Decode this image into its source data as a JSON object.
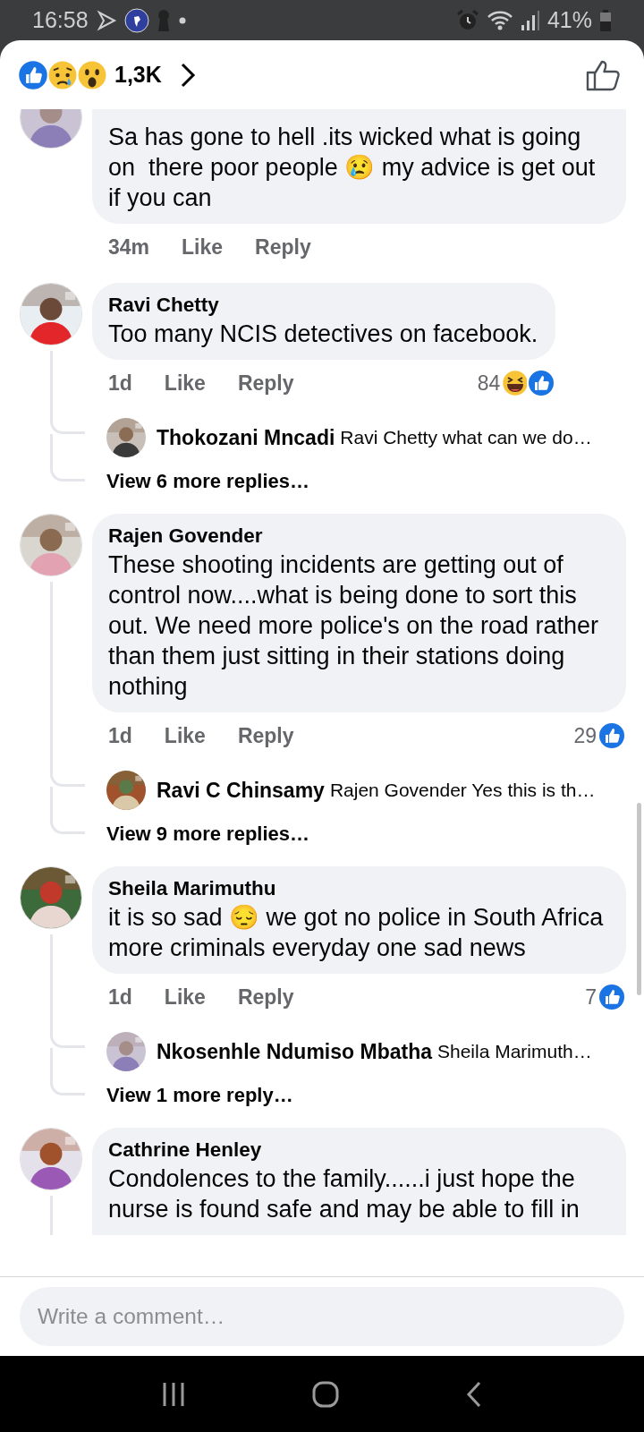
{
  "status_bar": {
    "time": "16:58",
    "battery": "41%"
  },
  "reactions_summary": {
    "icons": [
      {
        "kind": "like"
      },
      {
        "kind": "sad"
      },
      {
        "kind": "wow"
      }
    ],
    "count": "1,3K"
  },
  "comments": [
    {
      "body": "Sa has gone to hell .its wicked what is going on  there poor people 😢 my advice is get out if you can",
      "time": "34m",
      "like": "Like",
      "reply": "Reply"
    },
    {
      "author": "Ravi Chetty",
      "body": "Too many NCIS detectives on facebook.",
      "time": "1d",
      "like": "Like",
      "reply": "Reply",
      "reactions": {
        "count": "84",
        "icons": [
          {
            "kind": "haha"
          },
          {
            "kind": "like"
          }
        ]
      },
      "replies": [
        {
          "author": "Thokozani Mncadi",
          "text": "Ravi Chetty what can we do…"
        }
      ],
      "more": "View 6 more replies…"
    },
    {
      "author": "Rajen Govender",
      "body": "These shooting incidents are getting out of control now....what is being done to sort this out. We need more police's on the road rather than them just sitting in their stations doing nothing",
      "time": "1d",
      "like": "Like",
      "reply": "Reply",
      "reactions": {
        "count": "29",
        "icons": [
          {
            "kind": "like"
          }
        ]
      },
      "replies": [
        {
          "author": "Ravi C Chinsamy",
          "text": "Rajen Govender Yes this is th…"
        }
      ],
      "more": "View 9 more replies…"
    },
    {
      "author": "Sheila Marimuthu",
      "body": "it is so sad 😔 we got no police in South Africa more criminals everyday one sad news",
      "time": "1d",
      "like": "Like",
      "reply": "Reply",
      "reactions": {
        "count": "7",
        "icons": [
          {
            "kind": "like"
          }
        ]
      },
      "replies": [
        {
          "author": "Nkosenhle Ndumiso Mbatha",
          "text": "Sheila Marimuth…"
        }
      ],
      "more": "View 1 more reply…"
    },
    {
      "author": "Cathrine Henley",
      "body": "Condolences to the family......i just hope the nurse is found safe and may be able to fill in",
      "clipped": true
    }
  ],
  "composer": {
    "placeholder": "Write a comment…"
  }
}
